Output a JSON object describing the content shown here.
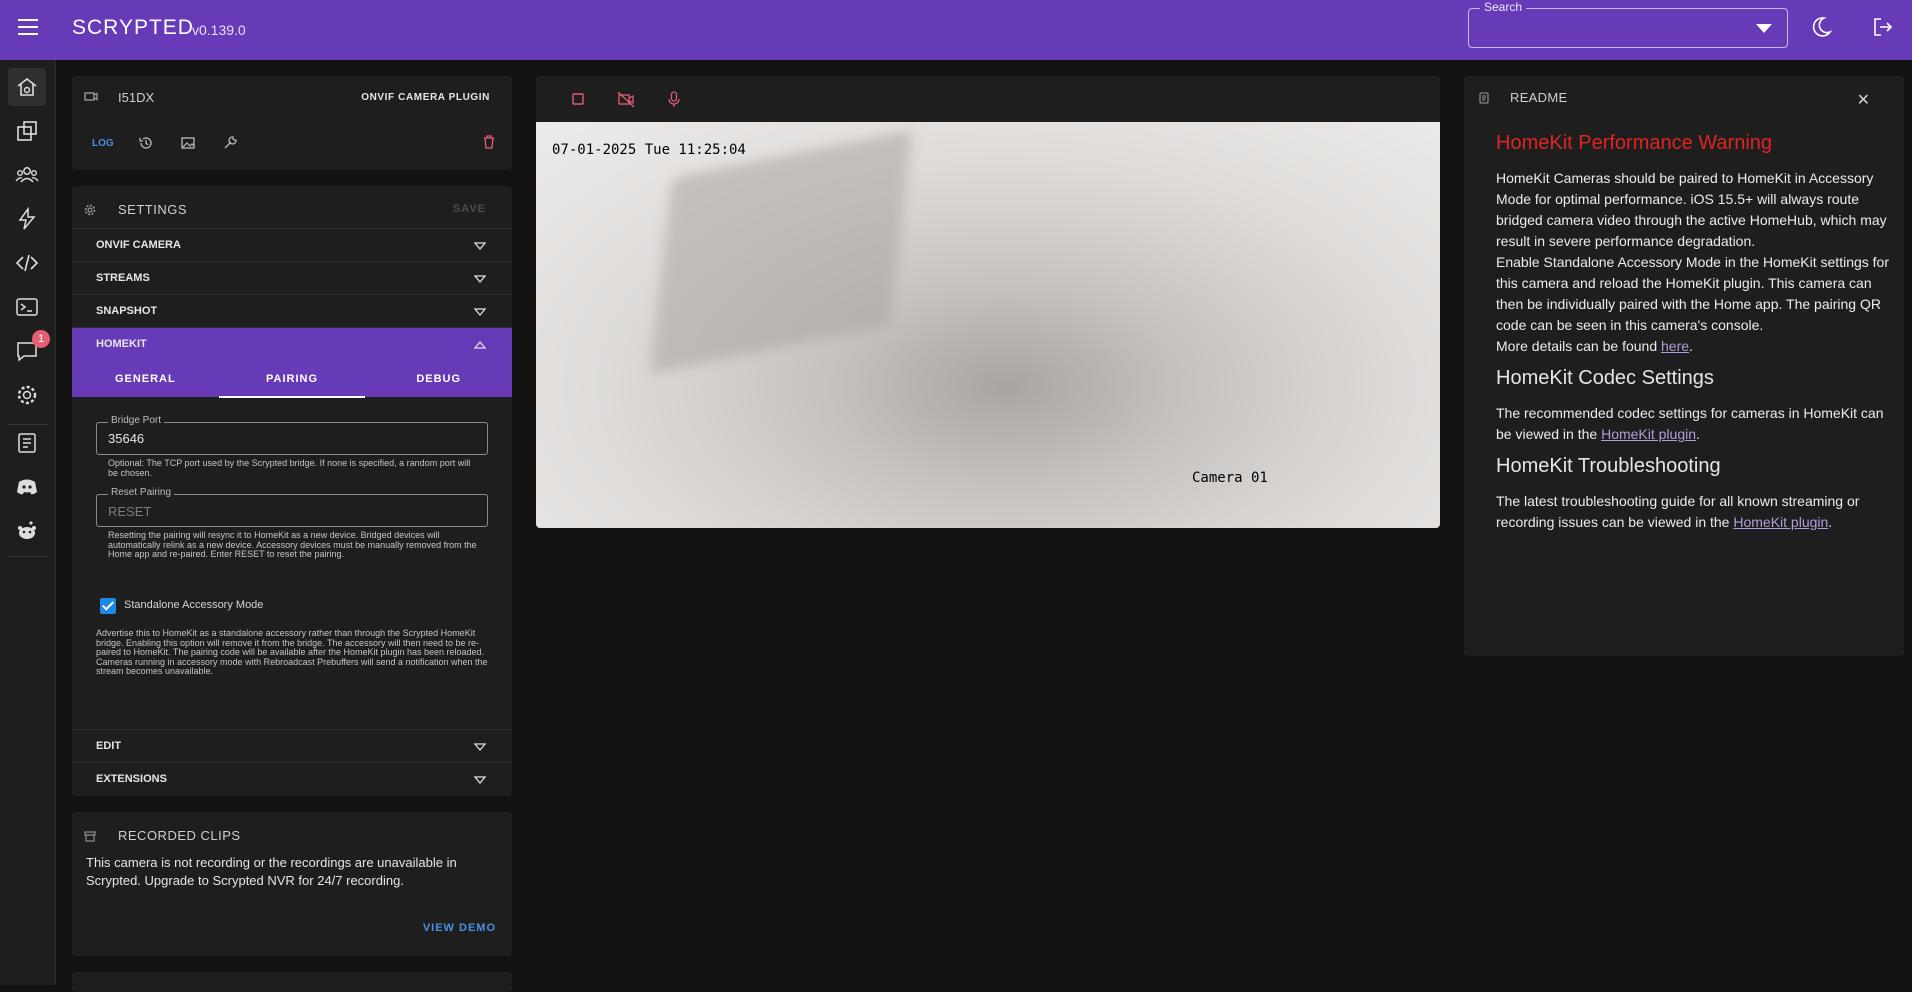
{
  "app": {
    "title": "SCRYPTED",
    "version": "v0.139.0"
  },
  "search": {
    "label": "Search"
  },
  "rail": {
    "notifications_badge": "1"
  },
  "device": {
    "name": "I51DX",
    "plugin": "ONVIF CAMERA PLUGIN",
    "log_label": "LOG"
  },
  "settings": {
    "title": "SETTINGS",
    "save_label": "SAVE",
    "sections": [
      "ONVIF CAMERA",
      "STREAMS",
      "SNAPSHOT",
      "HOMEKIT",
      "EDIT",
      "EXTENSIONS"
    ],
    "tabs": [
      "GENERAL",
      "PAIRING",
      "DEBUG"
    ],
    "bridge_port": {
      "label": "Bridge Port",
      "value": "35646",
      "help": "Optional: The TCP port used by the Scrypted bridge. If none is specified, a random port will be chosen."
    },
    "reset_pairing": {
      "label": "Reset Pairing",
      "placeholder": "RESET",
      "help": "Resetting the pairing will resync it to HomeKit as a new device. Bridged devices will automatically relink as a new device. Accessory devices must be manually removed from the Home app and re-paired. Enter RESET to reset the pairing."
    },
    "standalone": {
      "label": "Standalone Accessory Mode",
      "checked": true,
      "description": "Advertise this to HomeKit as a standalone accessory rather than through the Scrypted HomeKit bridge. Enabling this option will remove it from the bridge. The accessory will then need to be re-paired to HomeKit. The pairing code will be available after the HomeKit plugin has been reloaded. Cameras running in accessory mode with Rebroadcast Prebuffers will send a notification when the stream becomes unavailable."
    }
  },
  "clips": {
    "title": "RECORDED CLIPS",
    "text": "This camera is not recording or the recordings are unavailable in Scrypted. Upgrade to Scrypted NVR for 24/7 recording.",
    "demo_label": "VIEW DEMO"
  },
  "video": {
    "timestamp": "07-01-2025 Tue 11:25:04",
    "camera_label": "Camera 01"
  },
  "readme": {
    "title": "README",
    "h1": "HomeKit Performance Warning",
    "p1a": "HomeKit Cameras should be paired to HomeKit in Accessory Mode for optimal performance. iOS 15.5+ will always route bridged camera video through the active HomeHub, which may result in severe performance degradation.",
    "p1b": "Enable Standalone Accessory Mode in the HomeKit settings for this camera and reload the HomeKit plugin. This camera can then be individually paired with the Home app. The pairing QR code can be seen in this camera's console.",
    "p1c_prefix": "More details can be found ",
    "p1c_link": "here",
    "p1c_suffix": ".",
    "h2": "HomeKit Codec Settings",
    "p2_prefix": "The recommended codec settings for cameras in HomeKit can be viewed in the ",
    "p2_link": "HomeKit plugin",
    "p2_suffix": ".",
    "h3": "HomeKit Troubleshooting",
    "p3_prefix": "The latest troubleshooting guide for all known streaming or recording issues can be viewed in the ",
    "p3_link": "HomeKit plugin",
    "p3_suffix": "."
  },
  "colors": {
    "accent": "#673ab7",
    "warning": "#e02424",
    "link": "#4a90e2"
  }
}
